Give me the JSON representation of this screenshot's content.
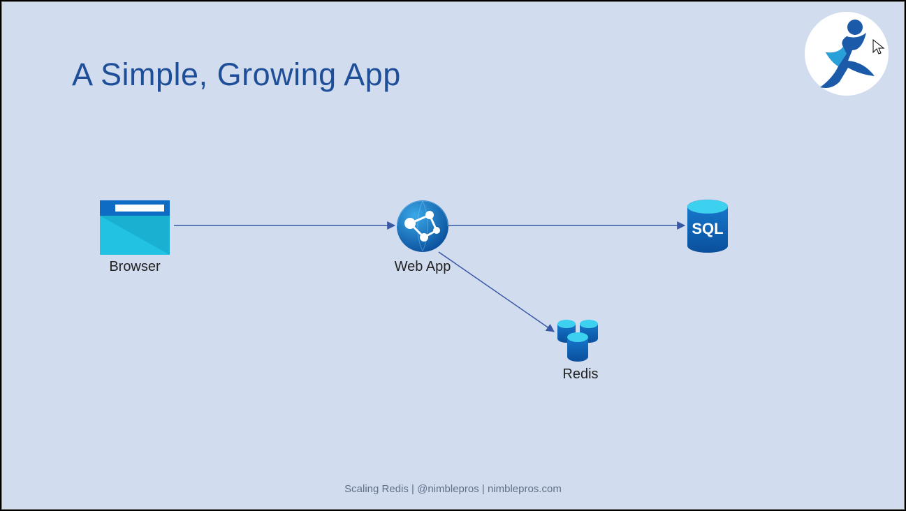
{
  "slide": {
    "title": "A Simple, Growing App",
    "footer": "Scaling Redis | @nimblepros | nimblepros.com"
  },
  "nodes": {
    "browser": {
      "label": "Browser"
    },
    "webapp": {
      "label": "Web App"
    },
    "sql": {
      "label": "SQL"
    },
    "redis": {
      "label": "Redis"
    }
  },
  "icons": {
    "browser": "browser-icon",
    "webapp": "webapp-icon",
    "sql": "sql-database-icon",
    "redis": "redis-cache-icon",
    "logo": "running-figure-icon",
    "cursor": "cursor-icon"
  },
  "arrows": [
    {
      "from": "browser",
      "to": "webapp"
    },
    {
      "from": "webapp",
      "to": "sql"
    },
    {
      "from": "webapp",
      "to": "redis"
    }
  ],
  "colors": {
    "slide_bg": "#d1dcee",
    "title": "#1f4e99",
    "arrow": "#3858a6",
    "azure_blue": "#0e6cc4",
    "azure_cyan": "#27c4e8"
  }
}
